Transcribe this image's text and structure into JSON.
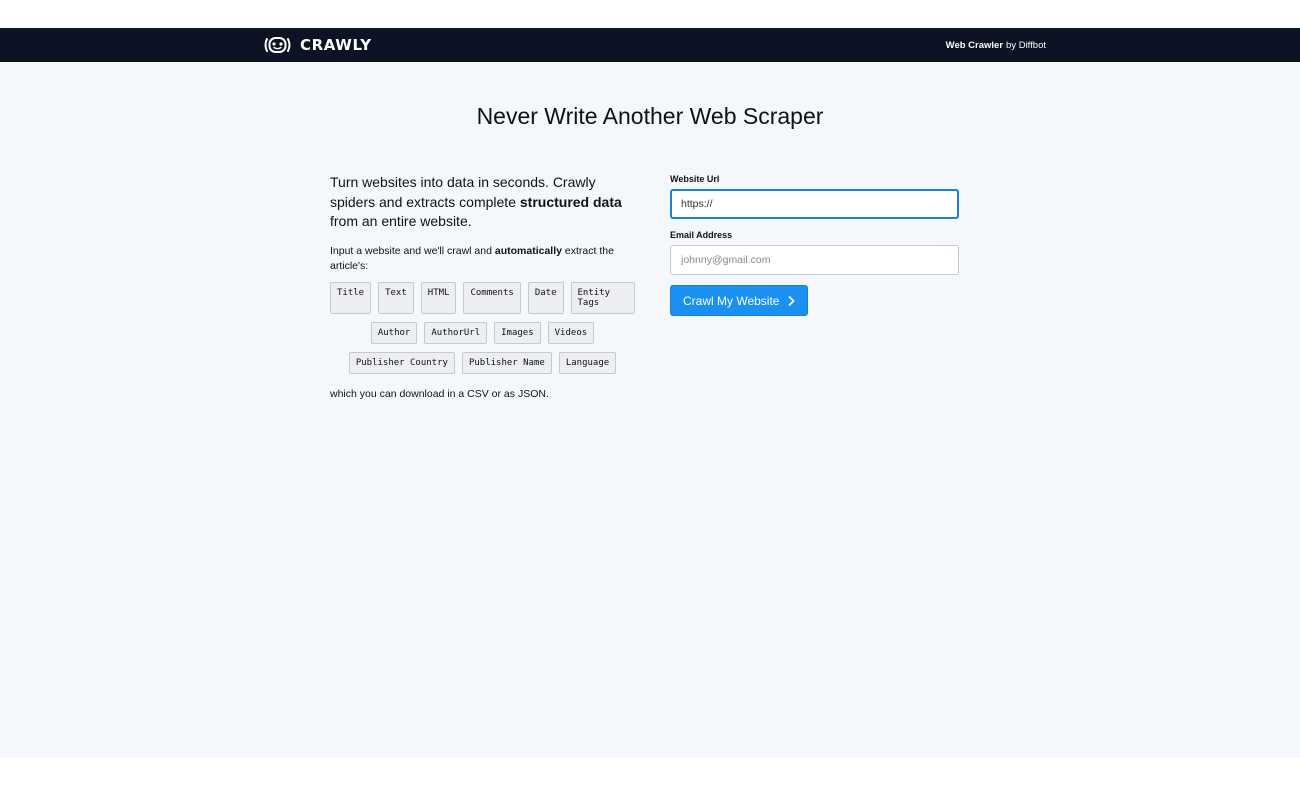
{
  "header": {
    "brand_name": "CRAWLY",
    "right_strong": "Web Crawler",
    "right_rest": "by Diffbot"
  },
  "hero": {
    "title": "Never Write Another Web Scraper"
  },
  "intro": {
    "lead_part1": "Turn websites into data in seconds. Crawly spiders and extracts complete ",
    "lead_bold": "structured data",
    "lead_part2": " from an entire website.",
    "sub_part1": "Input a website and we'll crawl and ",
    "sub_bold": "automatically",
    "sub_part2": " extract the article's:",
    "tag_rows": [
      [
        "Title",
        "Text",
        "HTML",
        "Comments",
        "Date",
        "Entity Tags"
      ],
      [
        "Author",
        "AuthorUrl",
        "Images",
        "Videos"
      ],
      [
        "Publisher Country",
        "Publisher Name",
        "Language"
      ]
    ],
    "download_note": "which you can download in a CSV or as JSON."
  },
  "form": {
    "url_label": "Website Url",
    "url_value": "https://",
    "email_label": "Email Address",
    "email_placeholder": "johnny@gmail.com",
    "submit_label": "Crawl My Website"
  },
  "icons": {
    "logo": "robot-face-icon",
    "submit": "chevron-right-icon"
  },
  "colors": {
    "topbar": "#0b1325",
    "background": "#f4f8fd",
    "accent": "#1a90f0"
  }
}
